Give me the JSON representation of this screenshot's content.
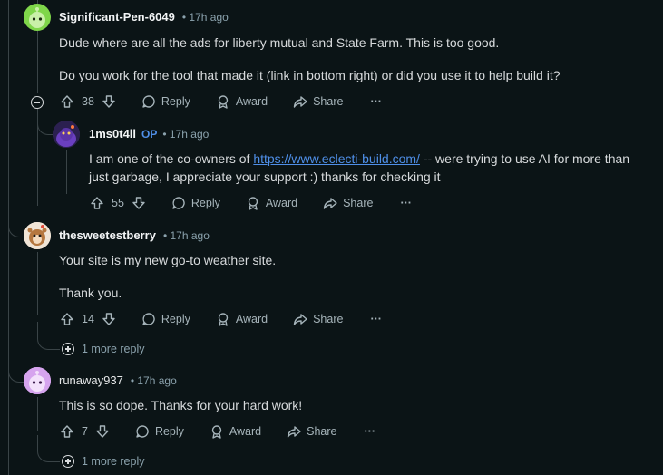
{
  "actions": {
    "reply": "Reply",
    "award": "Award",
    "share": "Share",
    "more": "···"
  },
  "comments": [
    {
      "username": "Significant-Pen-6049",
      "time": "• 17h ago",
      "lines": [
        "Dude where are all the ads for liberty mutual and State Farm. This is too good.",
        "Do you work for the tool that made it (link in bottom right) or did you use it to help build it?"
      ],
      "votes": "38"
    },
    {
      "username": "1ms0t4ll",
      "badge": "OP",
      "time": "• 17h ago",
      "text_before": "I am one of the co-owners of ",
      "link": "https://www.eclecti-build.com/",
      "text_after": " -- were trying to use AI for more than just garbage, I appreciate your support :) thanks for checking it",
      "votes": "55"
    },
    {
      "username": "thesweetestberry",
      "time": "• 17h ago",
      "lines": [
        "Your site is my new go-to weather site.",
        "Thank you."
      ],
      "votes": "14",
      "more_replies": "1 more reply"
    },
    {
      "username": "runaway937",
      "time": "• 17h ago",
      "lines": [
        "This is so dope. Thanks for your hard work!"
      ],
      "votes": "7",
      "more_replies": "1 more reply"
    }
  ]
}
